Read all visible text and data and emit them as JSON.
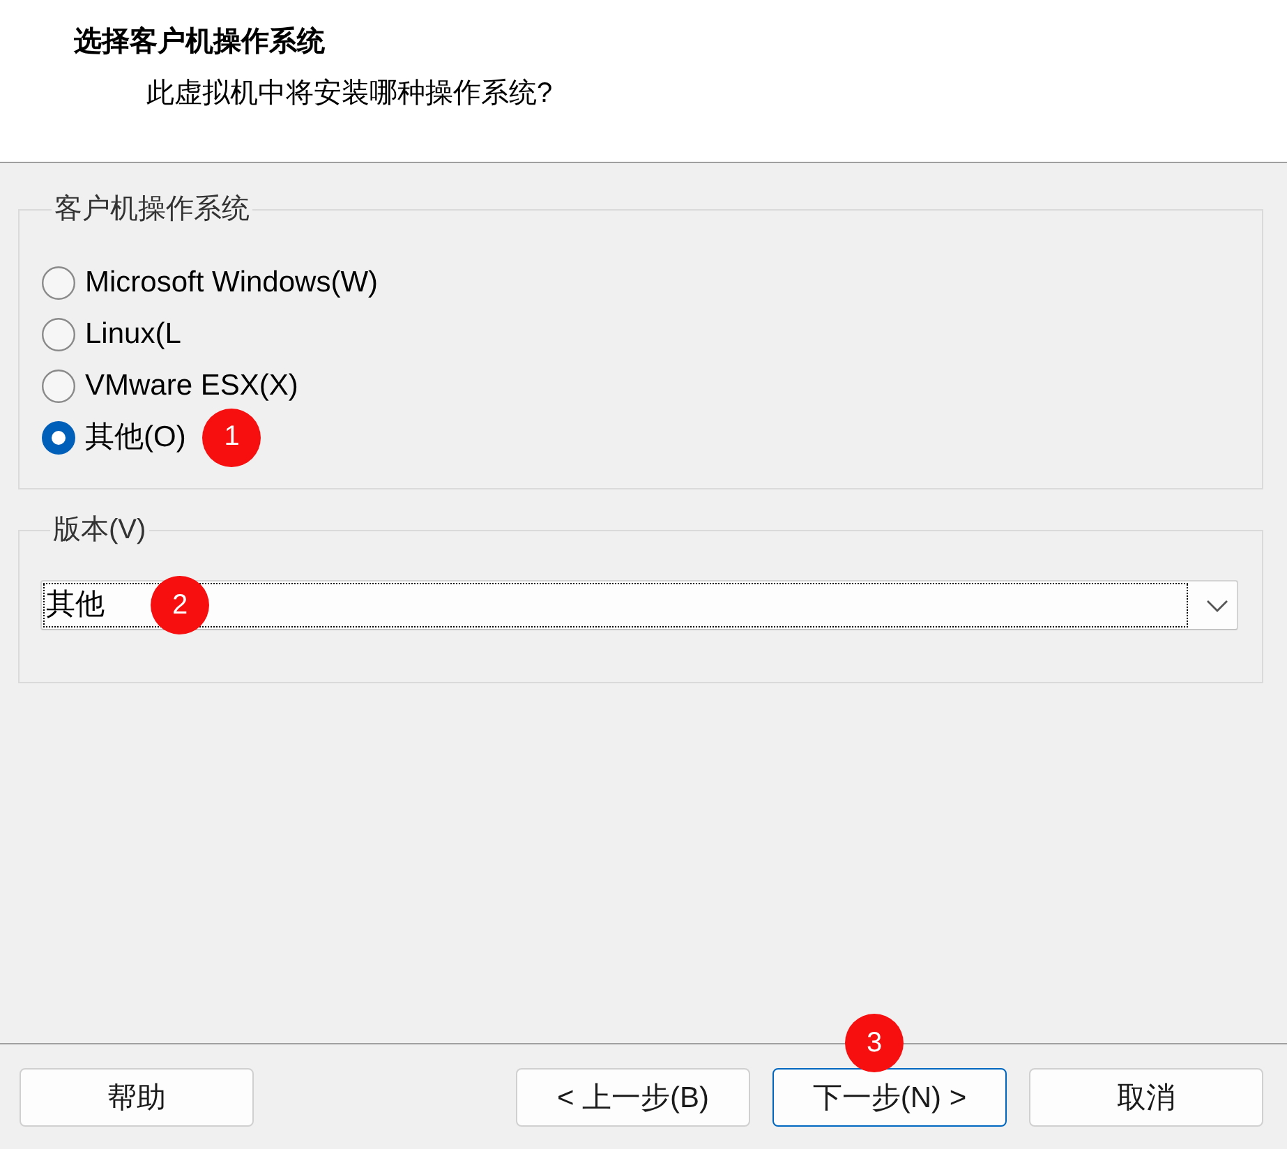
{
  "header": {
    "title": "选择客户机操作系统",
    "subtitle": "此虚拟机中将安装哪种操作系统?"
  },
  "guest_os_group": {
    "legend": "客户机操作系统",
    "options": [
      {
        "label": "Microsoft Windows(W)",
        "selected": false
      },
      {
        "label": "Linux(L",
        "selected": false
      },
      {
        "label": "VMware ESX(X)",
        "selected": false
      },
      {
        "label": "其他(O)",
        "selected": true,
        "annotation": "1"
      }
    ]
  },
  "version_group": {
    "legend": "版本(V)",
    "dropdown": {
      "value": "其他",
      "focused": true,
      "annotation": "2"
    }
  },
  "buttons": [
    {
      "label": "帮助",
      "default": false
    },
    {
      "label": "< 上一步(B)",
      "default": false
    },
    {
      "label": "下一步(N) >",
      "default": true,
      "annotation": "3"
    },
    {
      "label": "取消",
      "default": false
    }
  ]
}
